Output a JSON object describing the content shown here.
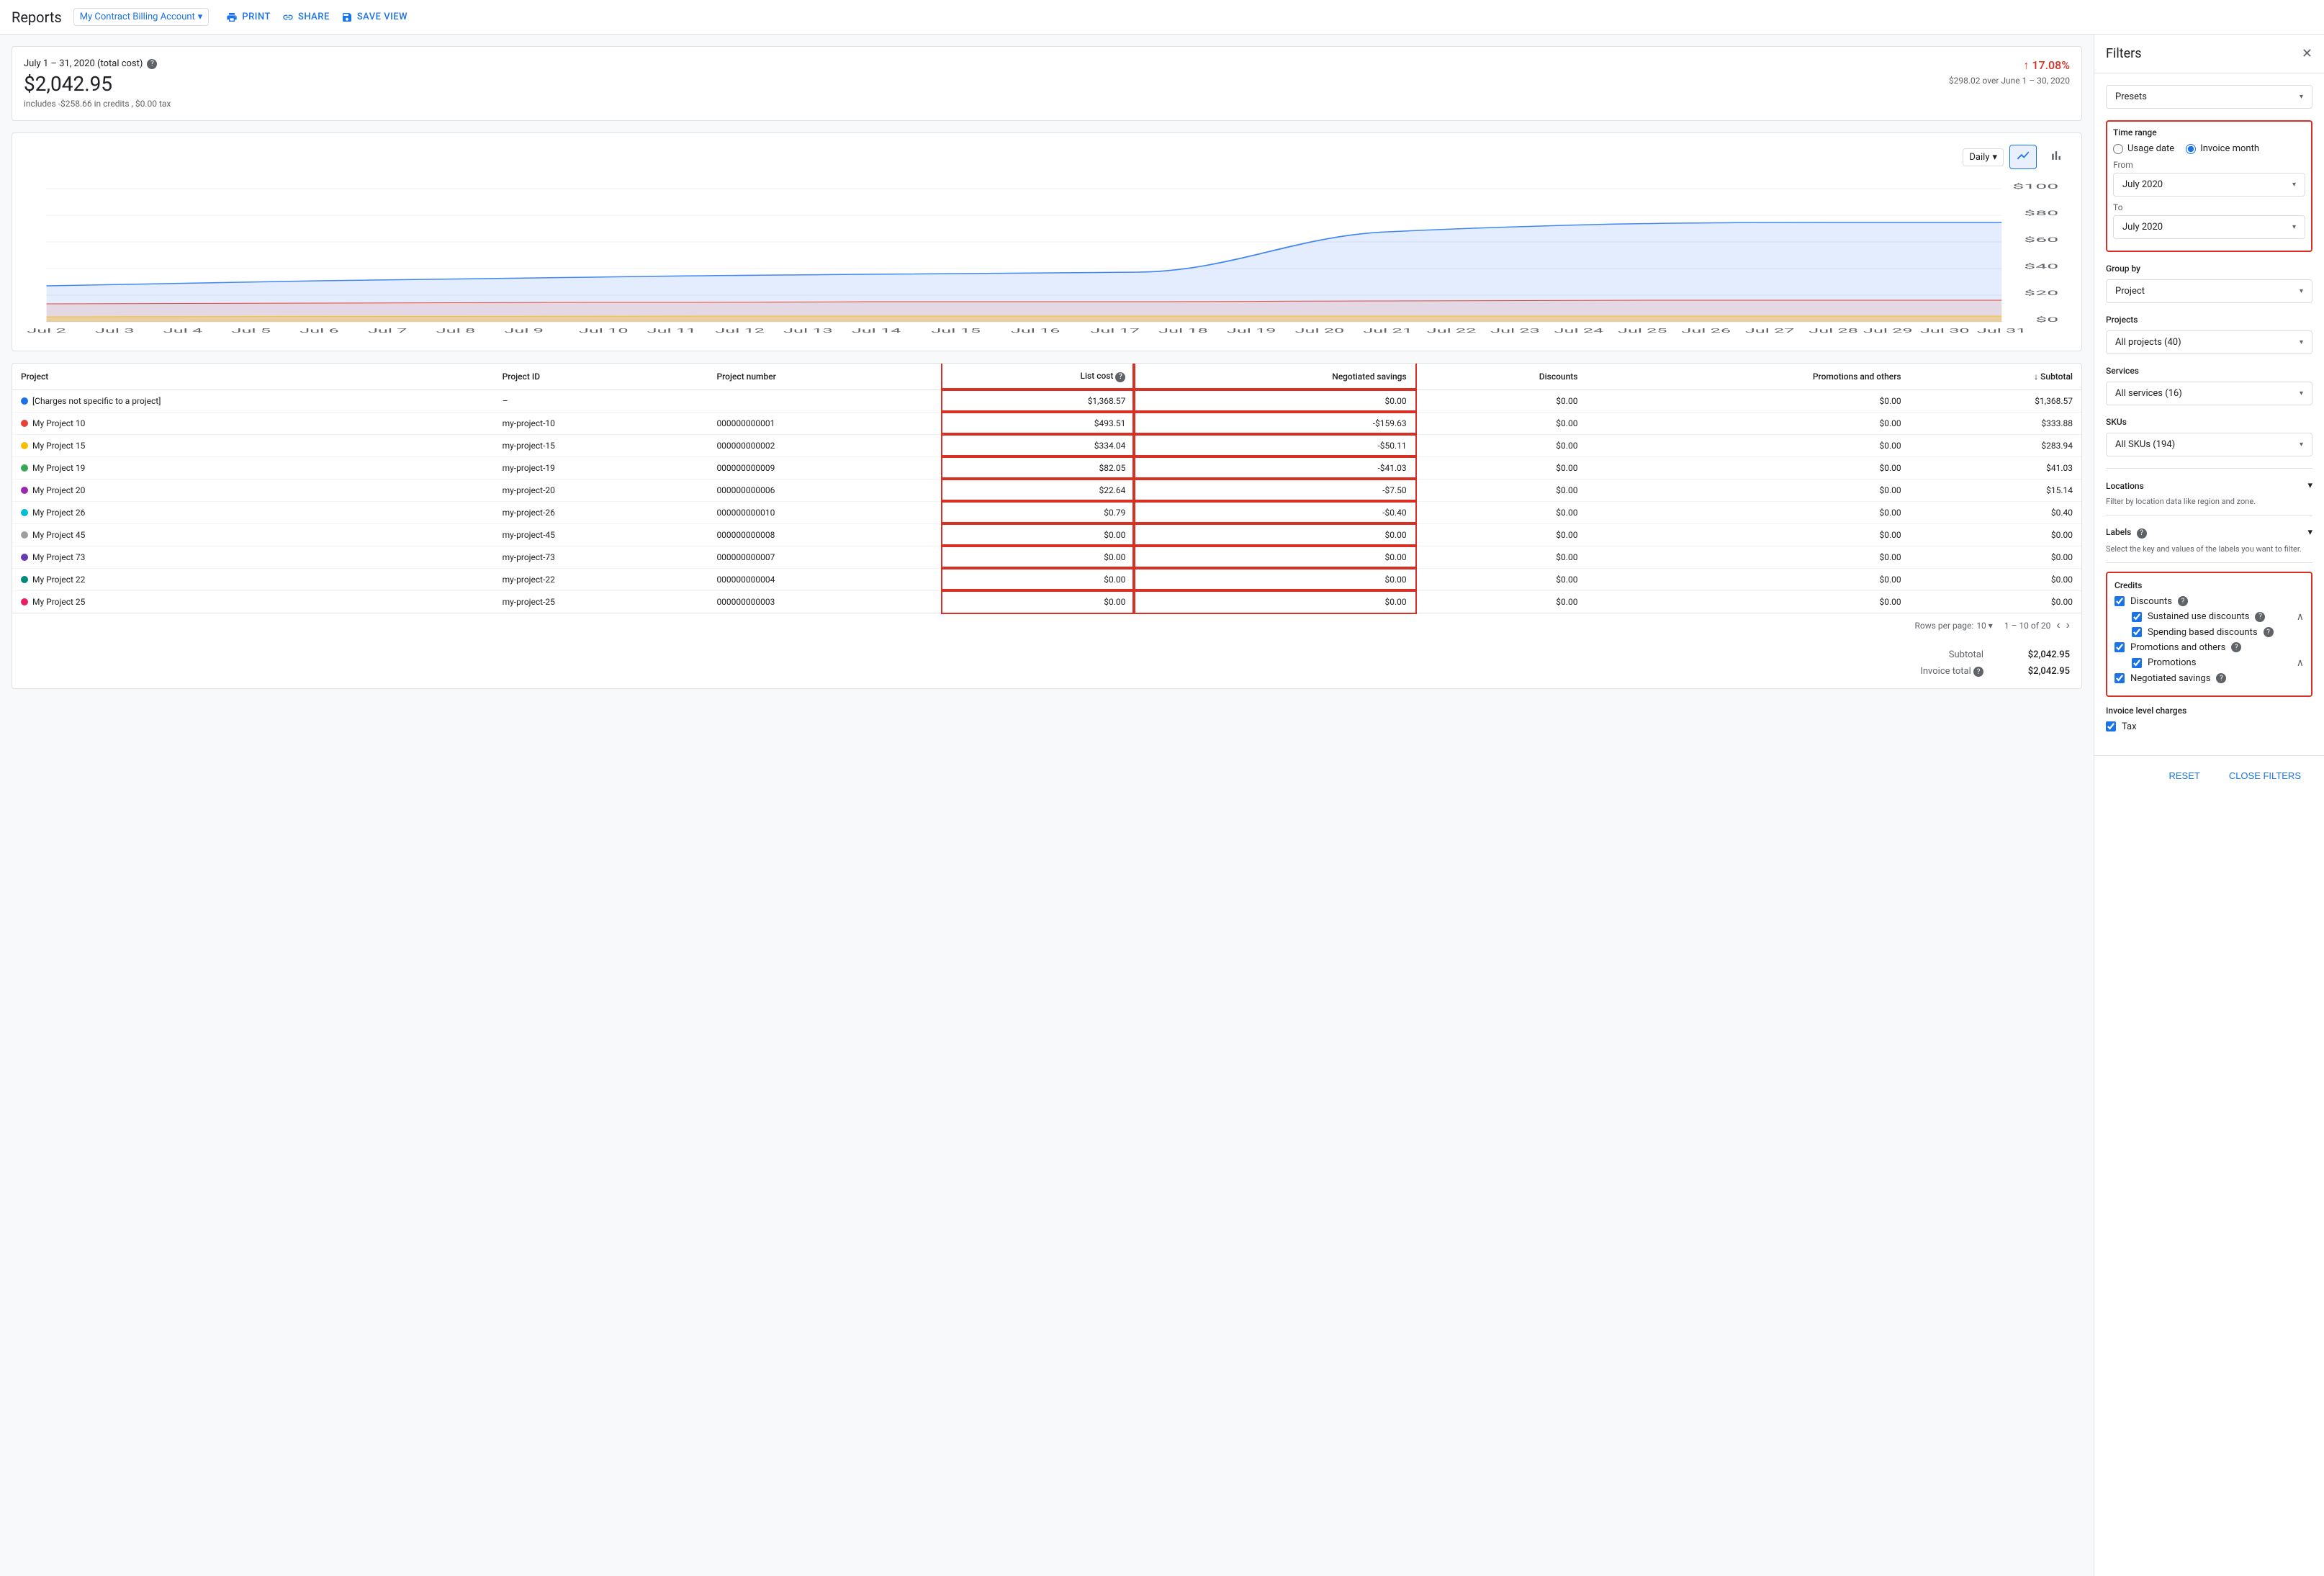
{
  "header": {
    "title": "Reports",
    "account": "My Contract Billing Account",
    "account_dropdown": "▾",
    "actions": [
      {
        "label": "PRINT",
        "icon": "print-icon"
      },
      {
        "label": "SHARE",
        "icon": "share-icon"
      },
      {
        "label": "SAVE VIEW",
        "icon": "save-icon"
      }
    ]
  },
  "summary": {
    "period": "July 1 – 31, 2020 (total cost)",
    "help_icon": "?",
    "amount": "$2,042.95",
    "details": "includes -$258.66 in credits , $0.00 tax",
    "change_pct": "17.08%",
    "change_direction": "up",
    "change_over": "$298.02 over June 1 – 30, 2020"
  },
  "chart": {
    "granularity": "Daily",
    "x_labels": [
      "Jul 2",
      "Jul 3",
      "Jul 4",
      "Jul 5",
      "Jul 6",
      "Jul 7",
      "Jul 8",
      "Jul 9",
      "Jul 10",
      "Jul 11",
      "Jul 12",
      "Jul 13",
      "Jul 14",
      "Jul 15",
      "Jul 16",
      "Jul 17",
      "Jul 18",
      "Jul 19",
      "Jul 20",
      "Jul 21",
      "Jul 22",
      "Jul 23",
      "Jul 24",
      "Jul 25",
      "Jul 26",
      "Jul 27",
      "Jul 28",
      "Jul 29",
      "Jul 30",
      "Jul 31"
    ],
    "y_labels": [
      "$0",
      "$20",
      "$40",
      "$60",
      "$80",
      "$100"
    ],
    "icon_line": "line-chart-icon",
    "icon_bar": "bar-chart-icon"
  },
  "table": {
    "columns": [
      "Project",
      "Project ID",
      "Project number",
      "List cost",
      "Negotiated savings",
      "Discounts",
      "Promotions and others",
      "Subtotal"
    ],
    "sort_column": "Subtotal",
    "sort_direction": "desc",
    "rows": [
      {
        "dot_color": "#1a73e8",
        "project": "[Charges not specific to a project]",
        "project_id": "–",
        "project_number": "",
        "list_cost": "$1,368.57",
        "negotiated_savings": "$0.00",
        "discounts": "$0.00",
        "promotions": "$0.00",
        "subtotal": "$1,368.57"
      },
      {
        "dot_color": "#e94235",
        "project": "My Project 10",
        "project_id": "my-project-10",
        "project_number": "000000000001",
        "list_cost": "$493.51",
        "negotiated_savings": "-$159.63",
        "discounts": "$0.00",
        "promotions": "$0.00",
        "subtotal": "$333.88"
      },
      {
        "dot_color": "#fbbc04",
        "project": "My Project 15",
        "project_id": "my-project-15",
        "project_number": "000000000002",
        "list_cost": "$334.04",
        "negotiated_savings": "-$50.11",
        "discounts": "$0.00",
        "promotions": "$0.00",
        "subtotal": "$283.94"
      },
      {
        "dot_color": "#34a853",
        "project": "My Project 19",
        "project_id": "my-project-19",
        "project_number": "000000000009",
        "list_cost": "$82.05",
        "negotiated_savings": "-$41.03",
        "discounts": "$0.00",
        "promotions": "$0.00",
        "subtotal": "$41.03"
      },
      {
        "dot_color": "#9c27b0",
        "project": "My Project 20",
        "project_id": "my-project-20",
        "project_number": "000000000006",
        "list_cost": "$22.64",
        "negotiated_savings": "-$7.50",
        "discounts": "$0.00",
        "promotions": "$0.00",
        "subtotal": "$15.14"
      },
      {
        "dot_color": "#00bcd4",
        "project": "My Project 26",
        "project_id": "my-project-26",
        "project_number": "000000000010",
        "list_cost": "$0.79",
        "negotiated_savings": "-$0.40",
        "discounts": "$0.00",
        "promotions": "$0.00",
        "subtotal": "$0.40"
      },
      {
        "dot_color": "#9e9e9e",
        "project": "My Project 45",
        "project_id": "my-project-45",
        "project_number": "000000000008",
        "list_cost": "$0.00",
        "negotiated_savings": "$0.00",
        "discounts": "$0.00",
        "promotions": "$0.00",
        "subtotal": "$0.00"
      },
      {
        "dot_color": "#673ab7",
        "project": "My Project 73",
        "project_id": "my-project-73",
        "project_number": "000000000007",
        "list_cost": "$0.00",
        "negotiated_savings": "$0.00",
        "discounts": "$0.00",
        "promotions": "$0.00",
        "subtotal": "$0.00"
      },
      {
        "dot_color": "#00897b",
        "project": "My Project 22",
        "project_id": "my-project-22",
        "project_number": "000000000004",
        "list_cost": "$0.00",
        "negotiated_savings": "$0.00",
        "discounts": "$0.00",
        "promotions": "$0.00",
        "subtotal": "$0.00"
      },
      {
        "dot_color": "#e91e63",
        "project": "My Project 25",
        "project_id": "my-project-25",
        "project_number": "000000000003",
        "list_cost": "$0.00",
        "negotiated_savings": "$0.00",
        "discounts": "$0.00",
        "promotions": "$0.00",
        "subtotal": "$0.00"
      }
    ],
    "pagination": {
      "rows_per_page_label": "Rows per page:",
      "rows_per_page": "10",
      "range": "1 – 10 of 20"
    },
    "totals": [
      {
        "label": "Subtotal",
        "value": "$2,042.95"
      },
      {
        "label": "Invoice total",
        "value": "$2,042.95"
      }
    ]
  },
  "filters": {
    "title": "Filters",
    "close_label": "✕",
    "presets_label": "Presets",
    "time_range": {
      "title": "Time range",
      "options": [
        "Usage date",
        "Invoice month"
      ],
      "selected": "Invoice month",
      "from_label": "From",
      "from_value": "July 2020",
      "to_label": "To",
      "to_value": "July 2020"
    },
    "group_by": {
      "title": "Group by",
      "value": "Project"
    },
    "projects": {
      "title": "Projects",
      "value": "All projects (40)"
    },
    "services": {
      "title": "Services",
      "value": "All services (16)"
    },
    "skus": {
      "title": "SKUs",
      "value": "All SKUs (194)"
    },
    "locations": {
      "title": "Locations",
      "description": "Filter by location data like region and zone."
    },
    "labels": {
      "title": "Labels",
      "help": "?",
      "description": "Select the key and values of the labels you want to filter."
    },
    "credits": {
      "title": "Credits",
      "items": [
        {
          "label": "Discounts",
          "checked": true,
          "help": true,
          "children": [
            {
              "label": "Sustained use discounts",
              "checked": true,
              "help": true,
              "expandable": true
            },
            {
              "label": "Spending based discounts",
              "checked": true,
              "help": true
            }
          ]
        },
        {
          "label": "Promotions and others",
          "checked": true,
          "help": true,
          "children": [
            {
              "label": "Promotions",
              "checked": true,
              "help": false,
              "expandable": true
            }
          ]
        },
        {
          "label": "Negotiated savings",
          "checked": true,
          "help": true
        }
      ]
    },
    "invoice_level": {
      "title": "Invoice level charges",
      "items": [
        {
          "label": "Tax",
          "checked": true
        }
      ]
    },
    "footer": {
      "reset_label": "RESET",
      "close_label": "CLOSE FILTERS"
    }
  }
}
